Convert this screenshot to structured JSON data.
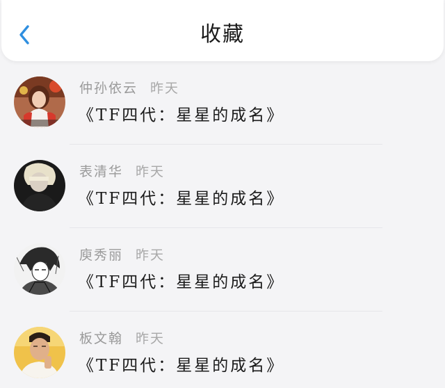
{
  "header": {
    "title": "收藏",
    "back_icon": "chevron-left-icon",
    "accent_color": "#2f8fe0"
  },
  "items": [
    {
      "name": "仲孙依云",
      "time": "昨天",
      "book": "《TF四代：星星的成名》"
    },
    {
      "name": "表清华",
      "time": "昨天",
      "book": "《TF四代：星星的成名》"
    },
    {
      "name": "庾秀丽",
      "time": "昨天",
      "book": "《TF四代：星星的成名》"
    },
    {
      "name": "板文翰",
      "time": "昨天",
      "book": "《TF四代：星星的成名》"
    }
  ]
}
